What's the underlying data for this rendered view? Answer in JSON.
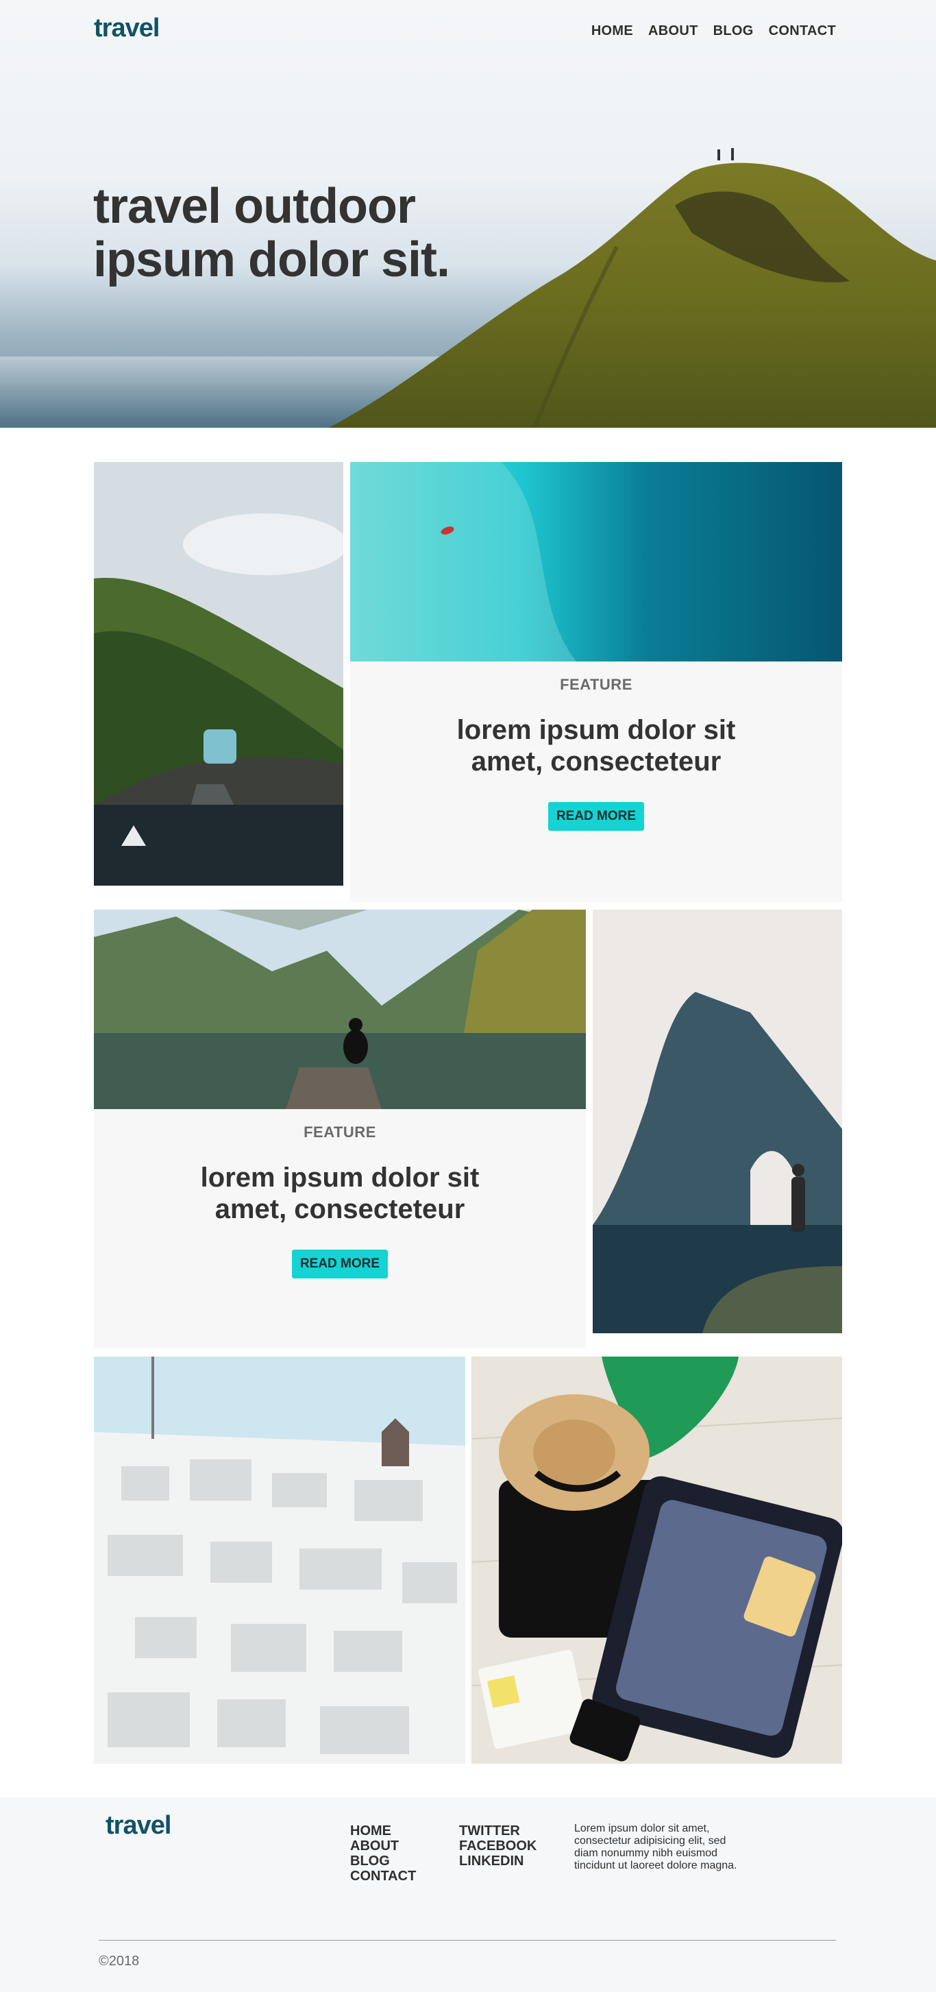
{
  "header": {
    "logo": "travel",
    "nav": [
      "HOME",
      "ABOUT",
      "BLOG",
      "CONTACT"
    ]
  },
  "hero": {
    "title": "travel outdoor ipsum dolor sit."
  },
  "cards": [
    {
      "kicker": "FEATURE",
      "title": "lorem ipsum dolor sit amet, consecteteur",
      "button": "READ MORE"
    },
    {
      "kicker": "FEATURE",
      "title": "lorem ipsum dolor sit amet, consecteteur",
      "button": "READ MORE"
    }
  ],
  "footer": {
    "logo": "travel",
    "links": [
      "HOME",
      "ABOUT",
      "BLOG",
      "CONTACT"
    ],
    "social": [
      "TWITTER",
      "FACEBOOK",
      "LINKEDIN"
    ],
    "text": "Lorem ipsum dolor sit amet, consectetur adipisicing elit, sed diam nonummy nibh euismod tincidunt ut laoreet dolore magna.",
    "copyright": "©2018"
  },
  "colors": {
    "brand": "#0f5365",
    "accent": "#14d3d3",
    "text": "#2f2f2f"
  }
}
